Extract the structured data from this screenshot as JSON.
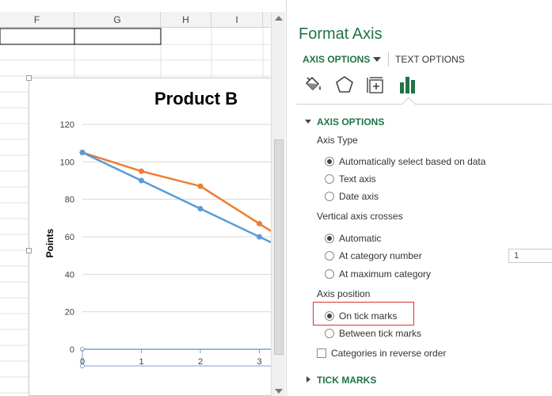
{
  "sheet": {
    "columns": [
      "F",
      "G",
      "H",
      "I"
    ]
  },
  "chart": {
    "title": "Product B",
    "ylabel": "Points",
    "colors": {
      "series1": "#5b9bd5",
      "series2": "#ed7d31",
      "axis": "#7f9fc8",
      "grid": "#d9d9d9"
    }
  },
  "chart_data": {
    "type": "line",
    "title": "Product B",
    "xlabel": "",
    "ylabel": "Points",
    "ylim": [
      0,
      120
    ],
    "yticks": [
      0,
      20,
      40,
      60,
      80,
      100,
      120
    ],
    "x": [
      0,
      1,
      2,
      3
    ],
    "grid": true,
    "series": [
      {
        "values": [
          105,
          90,
          75,
          60
        ]
      },
      {
        "values": [
          105,
          95,
          87,
          67
        ]
      }
    ]
  },
  "pane": {
    "title": "Format Axis",
    "tab_axis_options": "AXIS OPTIONS",
    "tab_text_options": "TEXT OPTIONS",
    "icons": [
      "fill-line-icon",
      "effects-icon",
      "size-properties-icon",
      "axis-options-icon"
    ],
    "sections": {
      "axis_options": "AXIS OPTIONS",
      "tick_marks": "TICK MARKS"
    },
    "axis_type": {
      "label": "Axis Type",
      "options": [
        {
          "label": "Automatically select based on data",
          "selected": true
        },
        {
          "label": "Text axis",
          "selected": false
        },
        {
          "label": "Date axis",
          "selected": false
        }
      ]
    },
    "vertical_axis_crosses": {
      "label": "Vertical axis crosses",
      "options": [
        {
          "label": "Automatic",
          "selected": true
        },
        {
          "label": "At category number",
          "selected": false
        },
        {
          "label": "At maximum category",
          "selected": false
        }
      ],
      "category_number_value": "1"
    },
    "axis_position": {
      "label": "Axis position",
      "options": [
        {
          "label": "On tick marks",
          "selected": true
        },
        {
          "label": "Between tick marks",
          "selected": false
        }
      ]
    },
    "reverse_order": {
      "label": "Categories in reverse order",
      "checked": false
    },
    "accent_color": "#217346",
    "highlight_color": "#e03030"
  }
}
